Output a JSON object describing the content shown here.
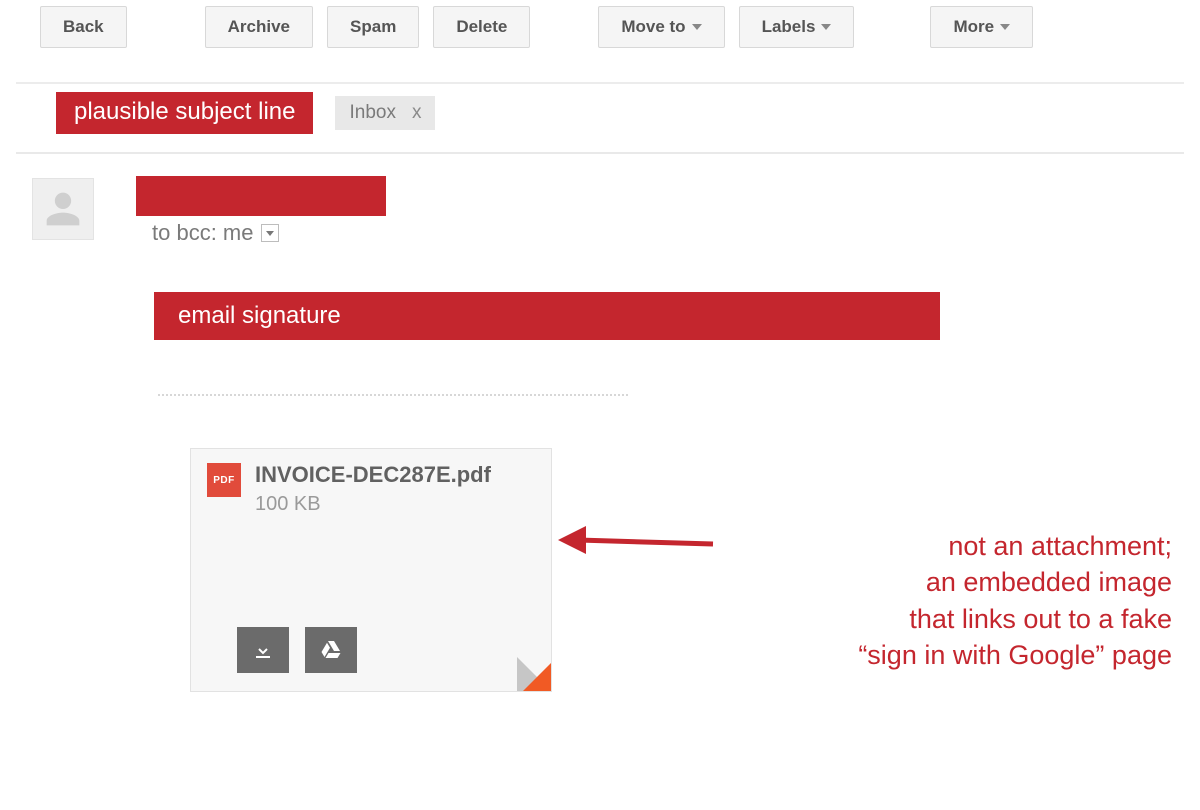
{
  "toolbar": {
    "back": "Back",
    "archive": "Archive",
    "spam": "Spam",
    "delete": "Delete",
    "move_to": "Move to",
    "labels": "Labels",
    "more": "More"
  },
  "subject": {
    "redacted_label": "plausible subject line",
    "chip_label": "Inbox",
    "chip_close": "x"
  },
  "sender": {
    "recipient_text": "to bcc: me"
  },
  "signature": {
    "redacted_label": "email signature"
  },
  "attachment": {
    "badge_text": "PDF",
    "filename": "INVOICE-DEC287E.pdf",
    "size": "100 KB"
  },
  "annotation": {
    "line1": "not an attachment;",
    "line2": "an embedded image",
    "line3": "that links out to a fake",
    "line4": "“sign in with Google” page"
  }
}
